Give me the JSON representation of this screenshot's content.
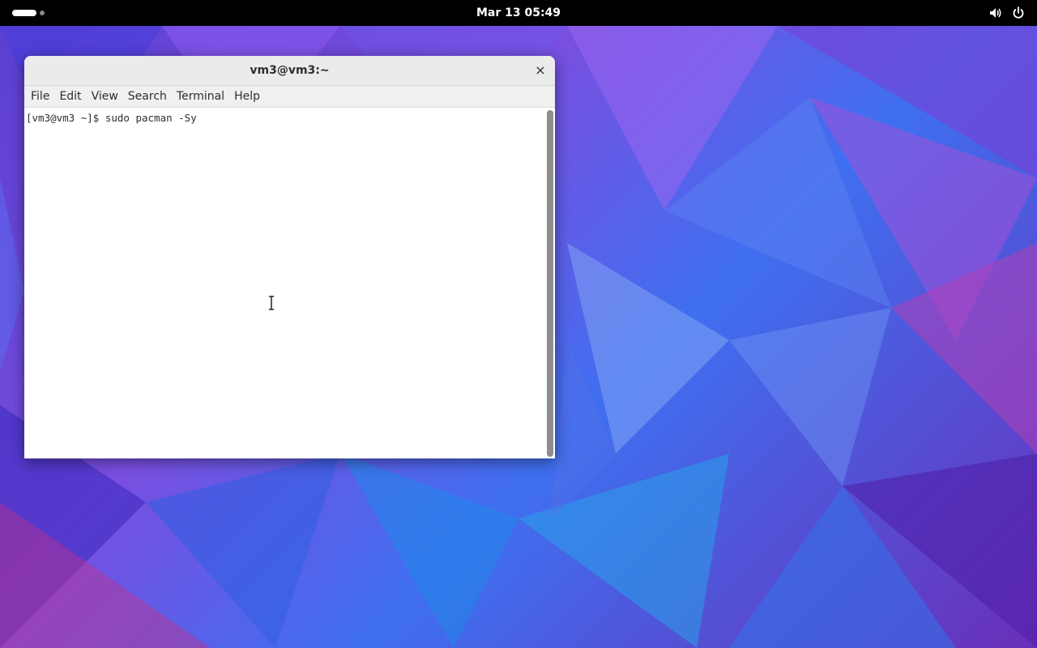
{
  "topbar": {
    "clock": "Mar 13  05:49",
    "tray_icons": [
      "volume-icon",
      "power-icon"
    ]
  },
  "terminal": {
    "title": "vm3@vm3:~",
    "close_glyph": "×",
    "menu": [
      "File",
      "Edit",
      "View",
      "Search",
      "Terminal",
      "Help"
    ],
    "lines": [
      "[vm3@vm3 ~]$ sudo pacman -Sy"
    ]
  },
  "colors": {
    "topbar": "#000000",
    "titlebar": "#ebebeb",
    "menubar": "#f0f0f0",
    "terminal_bg": "#ffffff",
    "terminal_fg": "#2e2e2e"
  }
}
